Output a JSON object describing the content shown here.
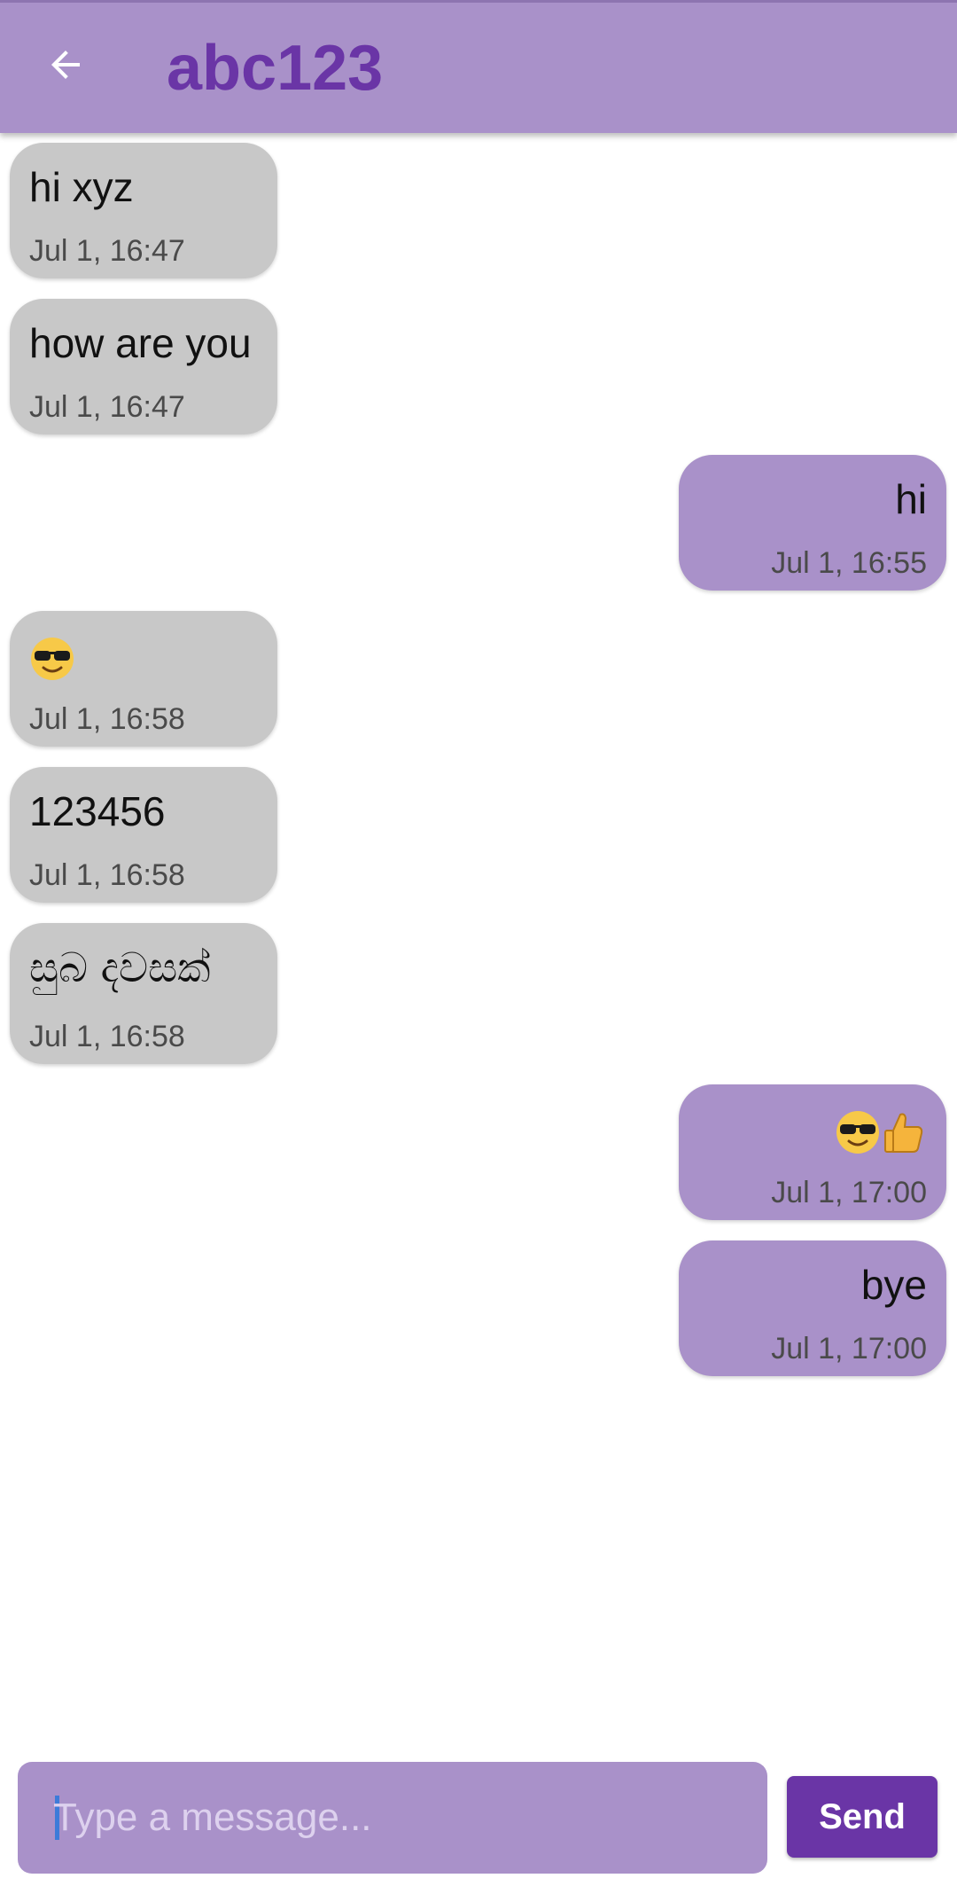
{
  "header": {
    "title": "abc123",
    "back_icon": "arrow-left-icon"
  },
  "colors": {
    "appbar": "#a991c9",
    "title": "#6a35a6",
    "incoming_bubble": "#c8c8c8",
    "outgoing_bubble": "#a991c9",
    "send_button": "#6a35a6"
  },
  "messages": [
    {
      "direction": "incoming",
      "text": "hi xyz",
      "time": "Jul 1, 16:47"
    },
    {
      "direction": "incoming",
      "text": "how are you",
      "time": "Jul 1, 16:47"
    },
    {
      "direction": "outgoing",
      "text": "hi",
      "time": "Jul 1, 16:55"
    },
    {
      "direction": "incoming",
      "text": "",
      "emoji": [
        "sunglasses-emoji"
      ],
      "time": "Jul 1, 16:58"
    },
    {
      "direction": "incoming",
      "text": "123456",
      "time": "Jul 1, 16:58"
    },
    {
      "direction": "incoming",
      "text": "සුබ දවසක්",
      "time": "Jul 1, 16:58"
    },
    {
      "direction": "outgoing",
      "text": "",
      "emoji": [
        "sunglasses-emoji",
        "thumbs-up-emoji"
      ],
      "time": "Jul 1, 17:00"
    },
    {
      "direction": "outgoing",
      "text": "bye",
      "time": "Jul 1, 17:00"
    }
  ],
  "composer": {
    "placeholder": "Type a message...",
    "value": "",
    "send_label": "Send"
  }
}
